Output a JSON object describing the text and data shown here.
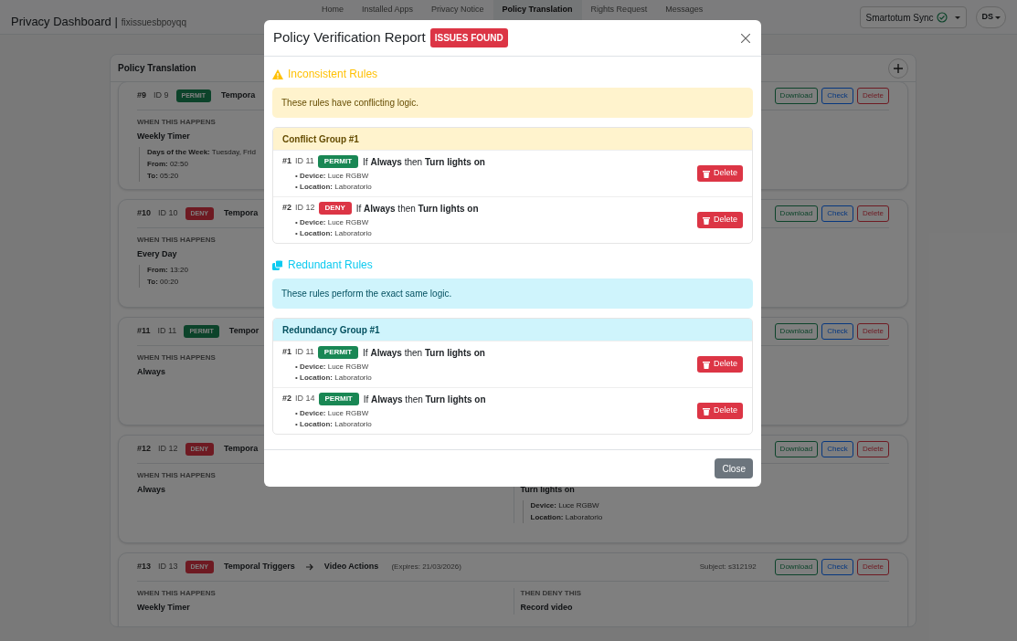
{
  "navbar": {
    "brand": "Privacy Dashboard |",
    "workspace": "fixissuesbpoyqq",
    "links": [
      {
        "label": "Home",
        "selected": false
      },
      {
        "label": "Installed Apps",
        "selected": false
      },
      {
        "label": "Privacy Notice",
        "selected": false
      },
      {
        "label": "Policy Translation",
        "selected": true
      },
      {
        "label": "Rights Request",
        "selected": false
      },
      {
        "label": "Messages",
        "selected": false
      }
    ],
    "sync": "Smartotum Sync",
    "user": "DS"
  },
  "panel": {
    "title": "Policy Translation",
    "cards": [
      {
        "number": "#9",
        "id": "ID 9",
        "kind": "permit",
        "badge": "PERMIT",
        "title": "Tempora",
        "trigger_label": "WHEN THIS HAPPENS",
        "trigger": "Weekly Timer",
        "trigger_details": [
          "**Days of the Week:** Tuesday, Frid",
          "**From:** 02:50",
          "**To:** 05:20"
        ],
        "buttons": [
          {
            "label": "Download",
            "kind": "download"
          },
          {
            "label": "Check",
            "kind": "check"
          },
          {
            "label": "Delete",
            "kind": "delete"
          }
        ]
      },
      {
        "number": "#10",
        "id": "ID 10",
        "kind": "deny",
        "badge": "DENY",
        "title": "Tempora",
        "trigger_label": "WHEN THIS HAPPENS",
        "trigger": "Every Day",
        "trigger_details": [
          "**From:** 13:20",
          "**To:** 00:20"
        ],
        "buttons": [
          {
            "label": "Download",
            "kind": "download"
          },
          {
            "label": "Check",
            "kind": "check"
          },
          {
            "label": "Delete",
            "kind": "delete"
          }
        ]
      },
      {
        "number": "#11",
        "id": "ID 11",
        "kind": "permit",
        "badge": "PERMIT",
        "title": "Tempor",
        "trigger_label": "WHEN THIS HAPPENS",
        "trigger": "Always",
        "buttons": [
          {
            "label": "Download",
            "kind": "download"
          },
          {
            "label": "Check",
            "kind": "check"
          },
          {
            "label": "Delete",
            "kind": "delete"
          }
        ]
      },
      {
        "number": "#12",
        "id": "ID 12",
        "kind": "deny",
        "badge": "DENY",
        "title": "Tempora",
        "trigger_label": "WHEN THIS HAPPENS",
        "trigger": "Always",
        "action": "Turn lights on",
        "action_details": [
          "**Device:** Luce RGBW",
          "**Location:** Laboratorio"
        ],
        "buttons": [
          {
            "label": "Download",
            "kind": "download"
          },
          {
            "label": "Check",
            "kind": "check"
          },
          {
            "label": "Delete",
            "kind": "delete"
          }
        ]
      },
      {
        "number": "#13",
        "id": "ID 13",
        "kind": "deny",
        "badge": "DENY",
        "title": "Temporal Triggers",
        "target": "Video Actions",
        "expires": "(Expires: 21/03/2026)",
        "subject": "Subject: s312192",
        "trigger_label": "WHEN THIS HAPPENS",
        "trigger": "Weekly Timer",
        "action_label": "THEN DENY THIS",
        "action": "Record video",
        "buttons": [
          {
            "label": "Download",
            "kind": "download"
          },
          {
            "label": "Check",
            "kind": "check"
          },
          {
            "label": "Delete",
            "kind": "delete"
          }
        ]
      }
    ]
  },
  "modal": {
    "title": "Policy Verification Report",
    "badge": "ISSUES FOUND",
    "sections": [
      {
        "kind": "conflict",
        "heading": "Inconsistent Rules",
        "message": "These rules have conflicting logic.",
        "groups": [
          {
            "title": "Conflict Group #1",
            "rules": [
              {
                "number": "#1",
                "id": "ID 11",
                "kind": "permit",
                "badge": "PERMIT",
                "text": "If **Always** then **Turn lights on**",
                "details": [
                  "• **Device:** Luce RGBW",
                  "• **Location:** Laboratorio"
                ],
                "button": "Delete"
              },
              {
                "number": "#2",
                "id": "ID 12",
                "kind": "deny",
                "badge": "DENY",
                "text": "If **Always** then **Turn lights on**",
                "details": [
                  "• **Device:** Luce RGBW",
                  "• **Location:** Laboratorio"
                ],
                "button": "Delete"
              }
            ]
          }
        ]
      },
      {
        "kind": "redundant",
        "heading": "Redundant Rules",
        "message": "These rules perform the exact same logic.",
        "groups": [
          {
            "title": "Redundancy Group #1",
            "rules": [
              {
                "number": "#1",
                "id": "ID 11",
                "kind": "permit",
                "badge": "PERMIT",
                "text": "If **Always** then **Turn lights on**",
                "details": [
                  "• **Device:** Luce RGBW",
                  "• **Location:** Laboratorio"
                ],
                "button": "Delete"
              },
              {
                "number": "#2",
                "id": "ID 14",
                "kind": "permit",
                "badge": "PERMIT",
                "text": "If **Always** then **Turn lights on**",
                "details": [
                  "• **Device:** Luce RGBW",
                  "• **Location:** Laboratorio"
                ],
                "button": "Delete"
              }
            ]
          }
        ]
      }
    ],
    "footer_button": "Close"
  }
}
